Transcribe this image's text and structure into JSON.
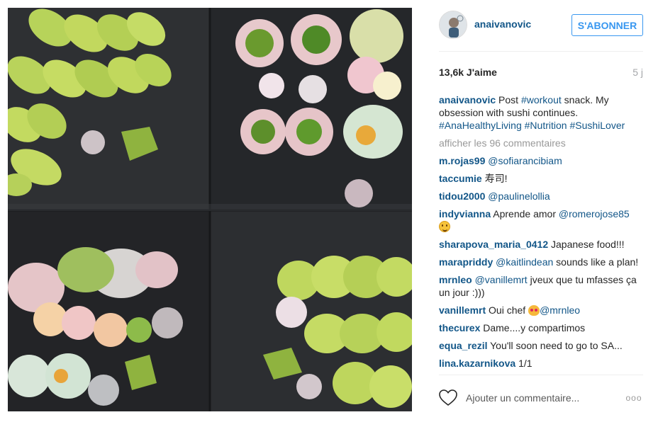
{
  "post": {
    "image_alt": "Sushi rolls with avocado and rice paper rolls on slate plates"
  },
  "header": {
    "username": "anaivanovic",
    "follow_label": "S'ABONNER"
  },
  "stats": {
    "likes": "13,6k J'aime",
    "time": "5 j"
  },
  "caption": {
    "user": "anaivanovic",
    "text_1": " Post ",
    "tag_workout": "#workout",
    "text_2": " snack. My obsession with sushi continues. ",
    "tag_1": "#AnaHealthyLiving",
    "tag_2": "#Nutrition",
    "tag_3": "#SushiLover"
  },
  "view_all": "afficher les 96 commentaires",
  "comments": [
    {
      "user": "m.rojas99",
      "text_before": "",
      "mention": "@sofiarancibiam",
      "text_after": ""
    },
    {
      "user": "taccumie",
      "text_before": "寿司!",
      "mention": "",
      "text_after": ""
    },
    {
      "user": "tidou2000",
      "text_before": "",
      "mention": "@paulinelollia",
      "text_after": ""
    },
    {
      "user": "indyvianna",
      "text_before": "Aprende amor ",
      "mention": "@romerojose85",
      "text_after": ""
    },
    {
      "user": "sharapova_maria_0412",
      "text_before": "Japanese food!!!",
      "mention": "",
      "text_after": ""
    },
    {
      "user": "marapriddy",
      "text_before": "",
      "mention": "@kaitlindean",
      "text_after": " sounds like a plan!"
    },
    {
      "user": "mrnleo",
      "text_before": "",
      "mention": "@vanillemrt",
      "text_after": " jveux que tu mfasses ça un jour :)))"
    },
    {
      "user": "vanillemrt",
      "text_before": "Oui chef ",
      "mention": "@mrnleo",
      "text_after": ""
    },
    {
      "user": "thecurex",
      "text_before": "Dame....y compartimos",
      "mention": "",
      "text_after": ""
    },
    {
      "user": "equa_rezil",
      "text_before": "You'll soon need to go to SA...",
      "mention": "",
      "text_after": ""
    },
    {
      "user": "lina.kazarnikova",
      "text_before": "1/1",
      "mention": "",
      "text_after": ""
    }
  ],
  "footer": {
    "comment_placeholder": "Ajouter un commentaire...",
    "more_label": "ooo"
  },
  "colors": {
    "link": "#125688",
    "follow": "#3897f0",
    "muted": "#999999"
  },
  "icons": {
    "like": "heart-outline-icon",
    "more": "ellipsis-icon"
  }
}
